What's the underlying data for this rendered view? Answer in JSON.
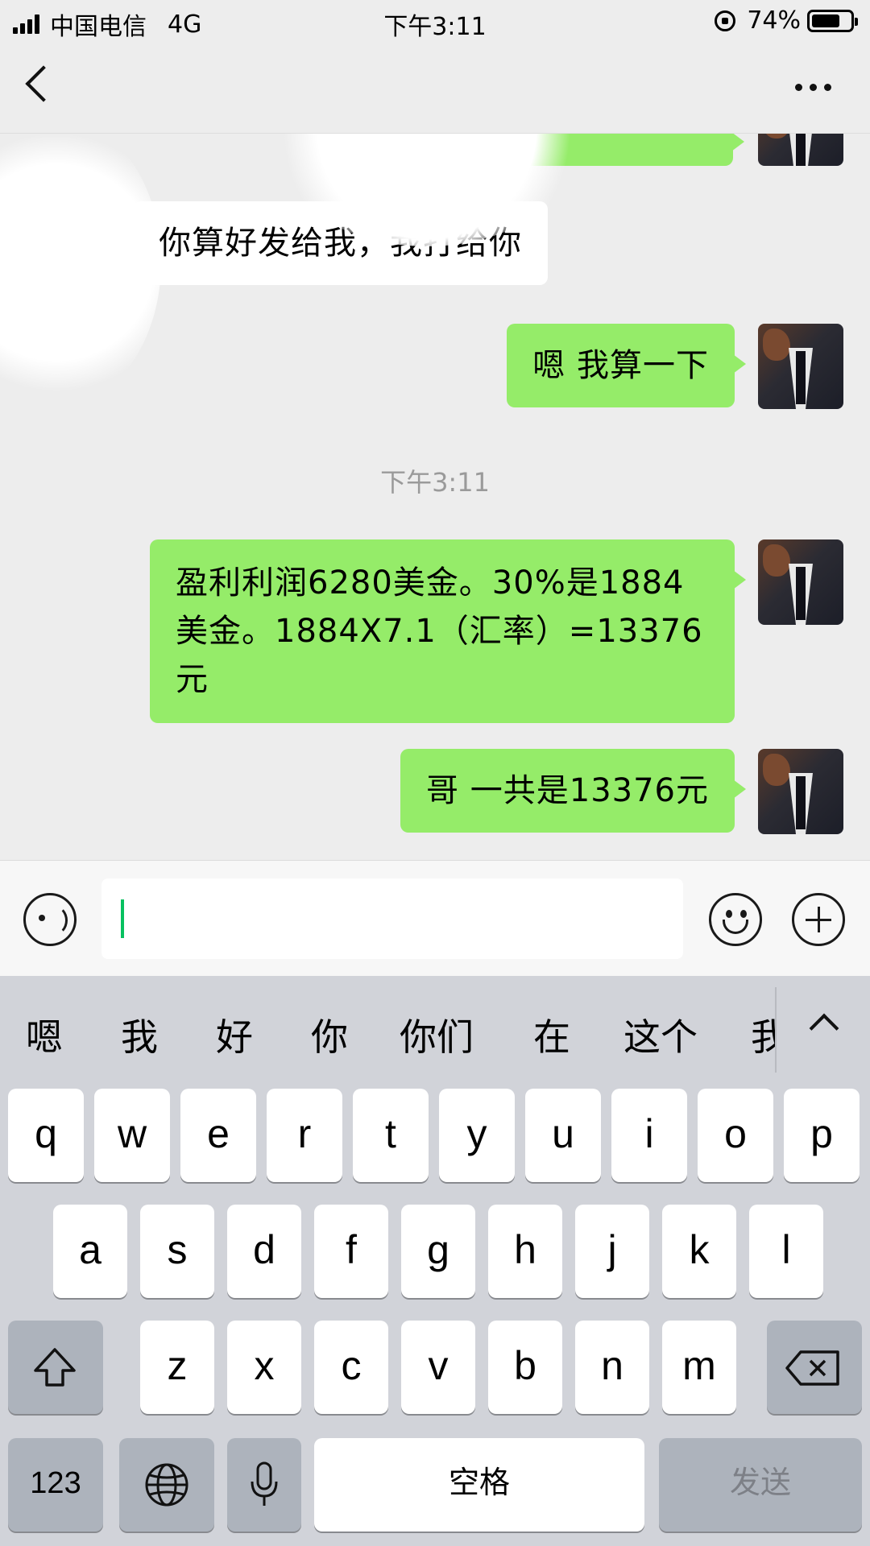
{
  "status_bar": {
    "carrier": "中国电信",
    "network": "4G",
    "time": "下午3:11",
    "battery_percent": "74%",
    "battery_level": 0.74
  },
  "nav": {
    "back_icon": "chevron-left-icon",
    "more_icon": "more-dots-icon"
  },
  "chat": {
    "messages": [
      {
        "side": "in",
        "text": "你算好发给我，我打给你"
      },
      {
        "side": "out",
        "text": "嗯 我算一下"
      },
      {
        "side": "out",
        "text": "盈利利润6280美金。30%是1884美金。1884X7.1（汇率）=13376元"
      },
      {
        "side": "out",
        "text": "哥 一共是13376元"
      }
    ],
    "timestamp": "下午3:11"
  },
  "input_bar": {
    "voice_icon": "voice-icon",
    "emoji_icon": "emoji-icon",
    "plus_icon": "plus-icon"
  },
  "keyboard": {
    "candidates": [
      "嗯",
      "我",
      "好",
      "你",
      "你们",
      "在",
      "这个",
      "我"
    ],
    "row1": [
      "q",
      "w",
      "e",
      "r",
      "t",
      "y",
      "u",
      "i",
      "o",
      "p"
    ],
    "row2": [
      "a",
      "s",
      "d",
      "f",
      "g",
      "h",
      "j",
      "k",
      "l"
    ],
    "row3": [
      "z",
      "x",
      "c",
      "v",
      "b",
      "n",
      "m"
    ],
    "numbers_label": "123",
    "space_label": "空格",
    "send_label": "发送"
  },
  "colors": {
    "outgoing_bubble": "#95ec69",
    "incoming_bubble": "#ffffff",
    "caret": "#07c160",
    "background": "#ededed"
  }
}
